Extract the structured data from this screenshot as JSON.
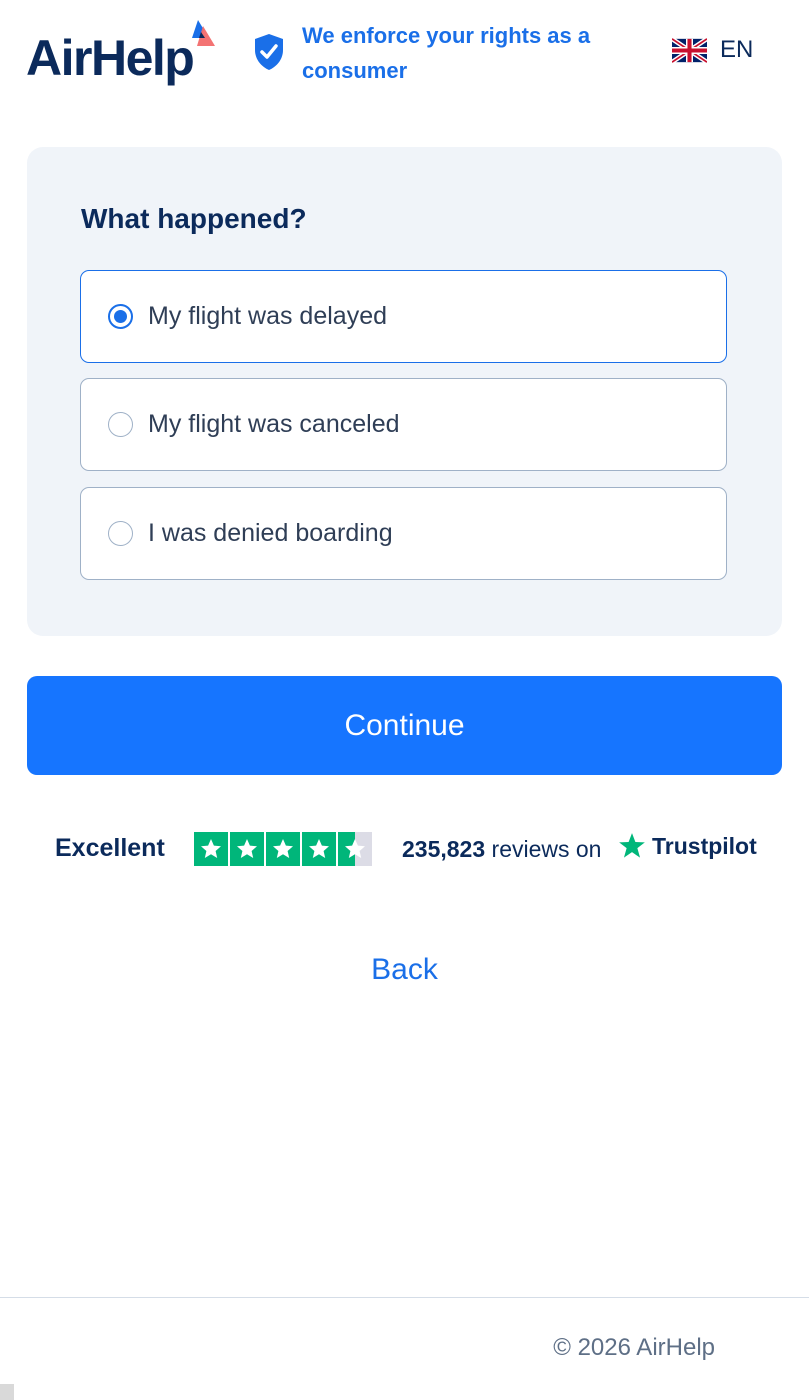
{
  "header": {
    "logo_text": "AirHelp",
    "tagline": "We enforce your rights as a consumer",
    "language": "EN",
    "icons": {
      "logo": "airhelp-logo-icon",
      "shield": "shield-check-icon",
      "flag": "uk-flag-icon"
    }
  },
  "form": {
    "question": "What happened?",
    "options": [
      {
        "label": "My flight was delayed",
        "selected": true
      },
      {
        "label": "My flight was canceled",
        "selected": false
      },
      {
        "label": "I was denied boarding",
        "selected": false
      }
    ],
    "continue_label": "Continue"
  },
  "trustpilot": {
    "rating_text": "Excellent",
    "stars": 4.5,
    "review_count": "235,823",
    "reviews_text": "reviews on",
    "brand": "Trustpilot"
  },
  "back_label": "Back",
  "footer": {
    "copyright": "© 2026 AirHelp"
  },
  "colors": {
    "brand_navy": "#0b2a5b",
    "brand_blue": "#1a6fe8",
    "button_blue": "#1675ff",
    "trustpilot_green": "#00b67a",
    "card_bg": "#f0f4f9"
  }
}
